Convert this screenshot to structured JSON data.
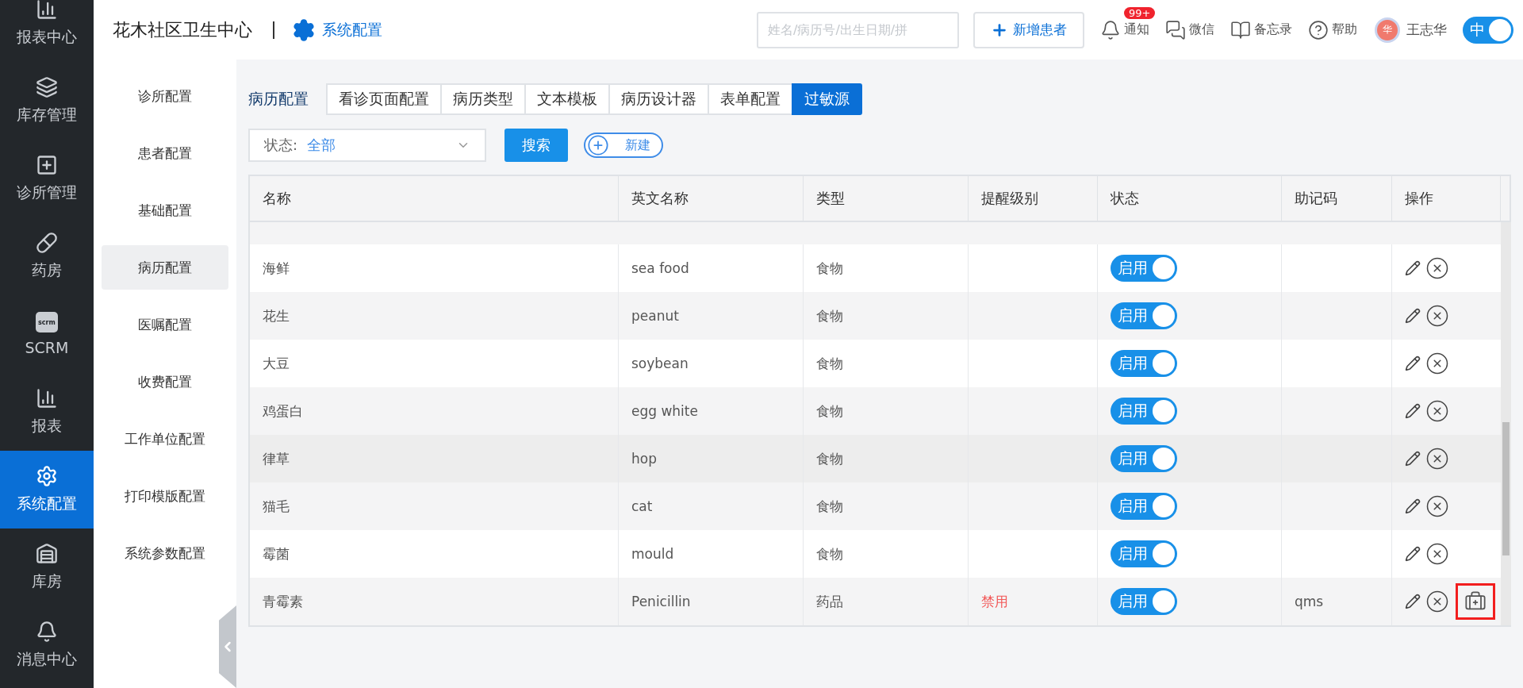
{
  "nav": [
    {
      "label": "报表中心",
      "kind": "chart",
      "selected": false
    },
    {
      "label": "库存管理",
      "kind": "layers",
      "selected": false
    },
    {
      "label": "诊所管理",
      "kind": "clinic",
      "selected": false
    },
    {
      "label": "药房",
      "kind": "pill",
      "selected": false
    },
    {
      "label": "SCRM",
      "kind": "scrm",
      "icon_text": "scrm",
      "selected": false
    },
    {
      "label": "报表",
      "kind": "chart",
      "selected": false
    },
    {
      "label": "系统配置",
      "kind": "gear",
      "selected": true
    },
    {
      "label": "库房",
      "kind": "warehouse",
      "selected": false
    },
    {
      "label": "消息中心",
      "kind": "bell",
      "selected": false
    }
  ],
  "header": {
    "org": "花木社区卫生中心",
    "section": "系统配置",
    "search_placeholder": "姓名/病历号/出生日期/拼",
    "add_patient": "新增患者",
    "tools": [
      {
        "kind": "bell",
        "label": "通知",
        "badge": "99+"
      },
      {
        "kind": "chat",
        "label": "微信"
      },
      {
        "kind": "memo",
        "label": "备忘录"
      },
      {
        "kind": "help",
        "label": "帮助"
      }
    ],
    "user": {
      "avatar_text": "华",
      "name": "王志华"
    },
    "lang_toggle": {
      "label": "中",
      "on": true
    }
  },
  "subnav": [
    {
      "label": "诊所配置",
      "selected": false
    },
    {
      "label": "患者配置",
      "selected": false
    },
    {
      "label": "基础配置",
      "selected": false
    },
    {
      "label": "病历配置",
      "selected": true
    },
    {
      "label": "医嘱配置",
      "selected": false
    },
    {
      "label": "收费配置",
      "selected": false
    },
    {
      "label": "工作单位配置",
      "selected": false
    },
    {
      "label": "打印模版配置",
      "selected": false
    },
    {
      "label": "系统参数配置",
      "selected": false
    }
  ],
  "tabs_label": "病历配置",
  "tabs": [
    {
      "label": "看诊页面配置",
      "selected": false
    },
    {
      "label": "病历类型",
      "selected": false
    },
    {
      "label": "文本模板",
      "selected": false
    },
    {
      "label": "病历设计器",
      "selected": false
    },
    {
      "label": "表单配置",
      "selected": false
    },
    {
      "label": "过敏源",
      "selected": true
    }
  ],
  "filter": {
    "label": "状态:",
    "value": "全部",
    "search": "搜索",
    "create": "新建"
  },
  "table": {
    "columns": [
      "名称",
      "英文名称",
      "类型",
      "提醒级别",
      "状态",
      "助记码",
      "操作"
    ],
    "rows": [
      {
        "name": "海鲜",
        "english": "sea food",
        "type": "食物",
        "level": "",
        "status": "启用",
        "enabled": true,
        "code": "",
        "hovered": false
      },
      {
        "name": "花生",
        "english": "peanut",
        "type": "食物",
        "level": "",
        "status": "启用",
        "enabled": true,
        "code": "",
        "hovered": false
      },
      {
        "name": "大豆",
        "english": "soybean",
        "type": "食物",
        "level": "",
        "status": "启用",
        "enabled": true,
        "code": "",
        "hovered": false
      },
      {
        "name": "鸡蛋白",
        "english": "egg white",
        "type": "食物",
        "level": "",
        "status": "启用",
        "enabled": true,
        "code": "",
        "hovered": false
      },
      {
        "name": "律草",
        "english": "hop",
        "type": "食物",
        "level": "",
        "status": "启用",
        "enabled": true,
        "code": "",
        "hovered": true
      },
      {
        "name": "猫毛",
        "english": "cat",
        "type": "食物",
        "level": "",
        "status": "启用",
        "enabled": true,
        "code": "",
        "hovered": false
      },
      {
        "name": "霉菌",
        "english": "mould",
        "type": "食物",
        "level": "",
        "status": "启用",
        "enabled": true,
        "code": "",
        "hovered": false
      },
      {
        "name": "青霉素",
        "english": "Penicillin",
        "type": "药品",
        "level": "禁用",
        "status": "启用",
        "enabled": true,
        "code": "qms",
        "hovered": false,
        "kit": true
      }
    ]
  }
}
